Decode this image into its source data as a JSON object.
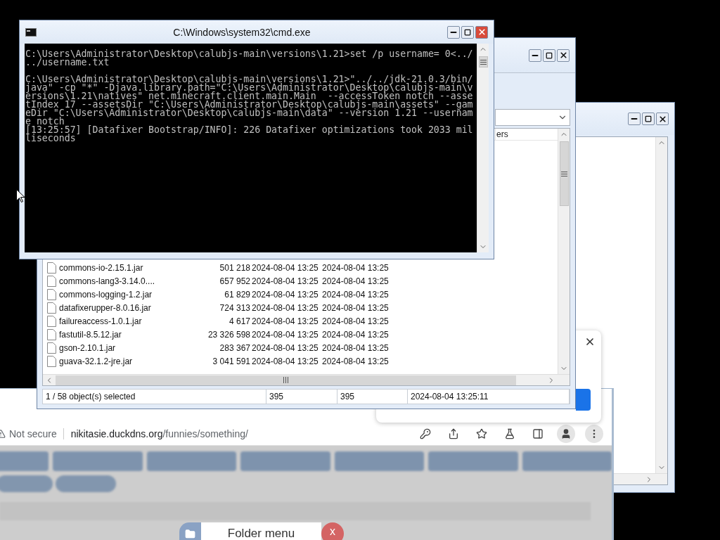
{
  "cmd_window": {
    "title": "C:\\Windows\\system32\\cmd.exe",
    "blocks": [
      {
        "lines": [
          "C:\\Users\\Administrator\\Desktop\\calubjs-main\\versions\\1.21>set /p username= 0<../",
          "../username.txt"
        ]
      },
      {
        "lines": [
          "C:\\Users\\Administrator\\Desktop\\calubjs-main\\versions\\1.21>\"../../jdk-21.0.3/bin/",
          "java\" -cp \"*\" -Djava.library.path=\"C:\\Users\\Administrator\\Desktop\\calubjs-main\\v",
          "ersions\\1.21\\natives\" net.minecraft.client.main.Main  --accessToken notch --asse",
          "tIndex 17 --assetsDir \"C:\\Users\\Administrator\\Desktop\\calubjs-main\\assets\" --gam",
          "eDir \"C:\\Users\\Administrator\\Desktop\\calubjs-main\\data\" --version 1.21 --usernam",
          "e notch",
          "[13:25:57] [Datafixer Bootstrap/INFO]: 226 Datafixer optimizations took 2033 mil",
          "liseconds"
        ]
      }
    ]
  },
  "explorer_window": {
    "column_header": "ers",
    "files": [
      {
        "name": "commons-io-2.15.1.jar",
        "size": "501 218",
        "created": "2024-08-04 13:25",
        "modified": "2024-08-04 13:25"
      },
      {
        "name": "commons-lang3-3.14.0....",
        "size": "657 952",
        "created": "2024-08-04 13:25",
        "modified": "2024-08-04 13:25"
      },
      {
        "name": "commons-logging-1.2.jar",
        "size": "61 829",
        "created": "2024-08-04 13:25",
        "modified": "2024-08-04 13:25"
      },
      {
        "name": "datafixerupper-8.0.16.jar",
        "size": "724 313",
        "created": "2024-08-04 13:25",
        "modified": "2024-08-04 13:25"
      },
      {
        "name": "failureaccess-1.0.1.jar",
        "size": "4 617",
        "created": "2024-08-04 13:25",
        "modified": "2024-08-04 13:25"
      },
      {
        "name": "fastutil-8.5.12.jar",
        "size": "23 326 598",
        "created": "2024-08-04 13:25",
        "modified": "2024-08-04 13:25"
      },
      {
        "name": "gson-2.10.1.jar",
        "size": "283 367",
        "created": "2024-08-04 13:25",
        "modified": "2024-08-04 13:25"
      },
      {
        "name": "guava-32.1.2-jre.jar",
        "size": "3 041 591",
        "created": "2024-08-04 13:25",
        "modified": "2024-08-04 13:25"
      }
    ],
    "status_bar": [
      "1 / 58 object(s) selected",
      "395",
      "395",
      "2024-08-04 13:25:11"
    ]
  },
  "browser": {
    "security": "Not secure",
    "url_host": "nikitasie.duckdns.org",
    "url_path": "/funnies/something/",
    "folder_menu": {
      "title": "Folder menu",
      "close": "x"
    }
  }
}
